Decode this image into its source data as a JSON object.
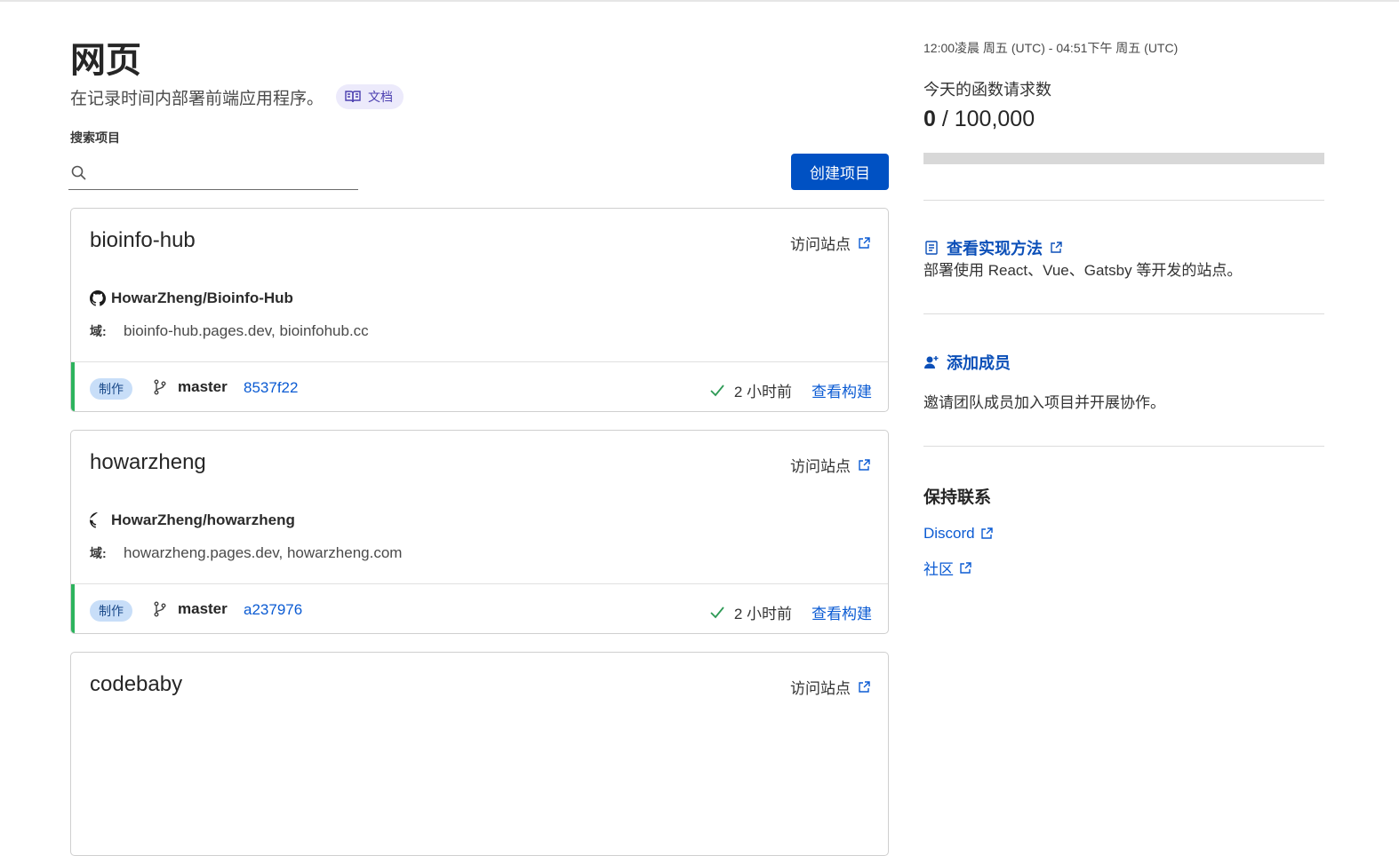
{
  "header": {
    "title": "网页",
    "subtitle": "在记录时间内部署前端应用程序。",
    "docs_label": "文档"
  },
  "search": {
    "label": "搜索项目",
    "value": "",
    "placeholder": ""
  },
  "create_button": "创建项目",
  "projects": [
    {
      "name": "bioinfo-hub",
      "visit_label": "访问站点",
      "repo": "HowarZheng/Bioinfo-Hub",
      "domain_label": "域:",
      "domains": "bioinfo-hub.pages.dev, bioinfohub.cc",
      "env_badge": "制作",
      "branch": "master",
      "commit": "8537f22",
      "time": "2 小时前",
      "view_build": "查看构建"
    },
    {
      "name": "howarzheng",
      "visit_label": "访问站点",
      "repo": "HowarZheng/howarzheng",
      "domain_label": "域:",
      "domains": "howarzheng.pages.dev, howarzheng.com",
      "env_badge": "制作",
      "branch": "master",
      "commit": "a237976",
      "time": "2 小时前",
      "view_build": "查看构建"
    },
    {
      "name": "codebaby",
      "visit_label": "访问站点"
    }
  ],
  "usage": {
    "range": "12:00凌晨 周五 (UTC) - 04:51下午 周五 (UTC)",
    "label": "今天的函数请求数",
    "used": "0",
    "separator": " / ",
    "limit": "100,000",
    "fraction": 0
  },
  "resources": {
    "guide_link": "查看实现方法",
    "guide_text": "部署使用 React、Vue、Gatsby 等开发的站点。",
    "members_link": "添加成员",
    "members_text": "邀请团队成员加入项目并开展协作。"
  },
  "contact": {
    "title": "保持联系",
    "links": [
      "Discord",
      "社区"
    ]
  },
  "colors": {
    "primary": "#0051c3",
    "link": "#0b5bd3",
    "success": "#2db35d",
    "badge_bg": "#c8def8"
  }
}
